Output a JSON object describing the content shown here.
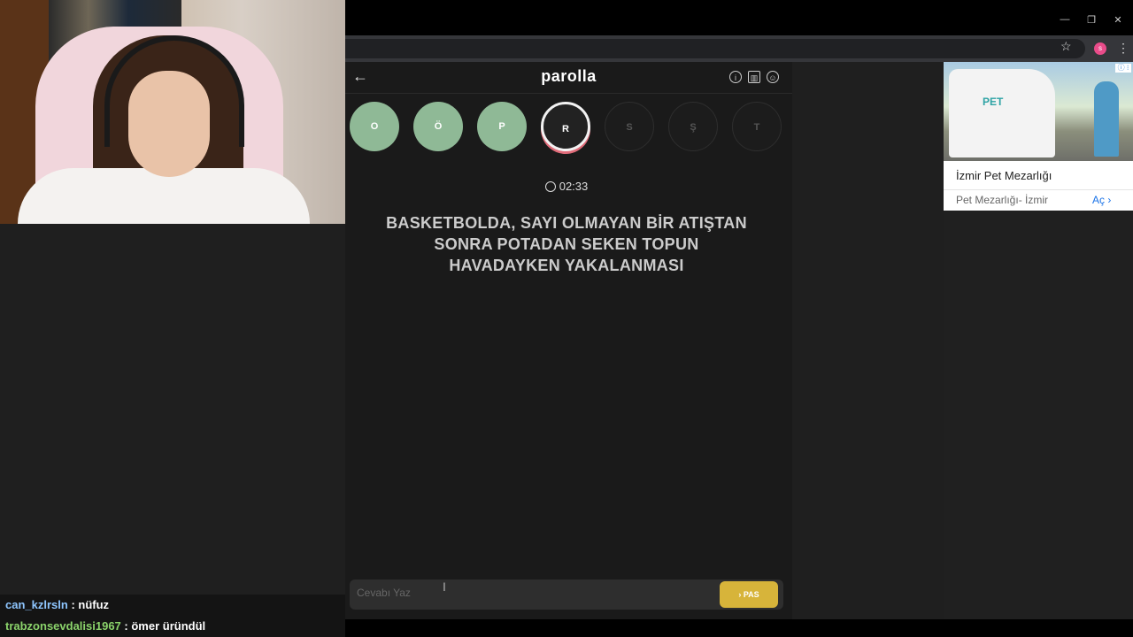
{
  "chat": [
    {
      "user": "can_kzlrsln",
      "user_color": "#8ec6ff",
      "message": " : nüfuz"
    },
    {
      "user": "trabzonsevdalisi1967",
      "user_color": "#8bd36b",
      "message": " : ömer üründül"
    }
  ],
  "browser": {
    "minimize": "—",
    "restore": "❐",
    "close": "✕",
    "star_icon": "☆",
    "profile_initial": "s",
    "menu_icon": "⋮"
  },
  "game": {
    "logo": "parolla",
    "back_icon": "←",
    "info_icon": "i",
    "stats_icon": "▥",
    "profile_icon": "☺",
    "letters": [
      {
        "letter": "O",
        "state": "done"
      },
      {
        "letter": "Ö",
        "state": "done"
      },
      {
        "letter": "P",
        "state": "done"
      },
      {
        "letter": "R",
        "state": "current"
      },
      {
        "letter": "S",
        "state": "pending"
      },
      {
        "letter": "Ş",
        "state": "pending"
      },
      {
        "letter": "T",
        "state": "pending"
      }
    ],
    "timer": "02:33",
    "question": "BASKETBOLDA, SAYI OLMAYAN BİR ATIŞTAN SONRA POTADAN SEKEN TOPUN HAVADAYKEN YAKALANMASI",
    "input_placeholder": "Cevabı Yaz",
    "pass_label": "PAS",
    "pass_icon": "›",
    "colors": {
      "done": "#8fb996",
      "current_ring": "#e06c7a",
      "pass": "#d7b43a"
    }
  },
  "ad": {
    "van_text": "PET",
    "badge": "ⓘ ⁝",
    "title": "İzmir Pet Mezarlığı",
    "subtitle": "Pet Mezarlığı- İzmir",
    "cta": "Aç",
    "cta_icon": "›"
  }
}
